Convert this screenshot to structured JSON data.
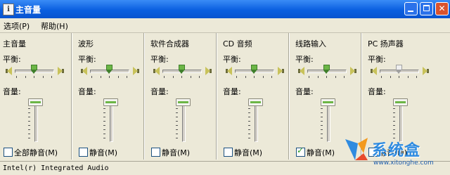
{
  "window": {
    "title": "主音量",
    "app_icon": "i",
    "minimize_icon": "minimize-icon",
    "maximize_icon": "maximize-icon",
    "close_icon": "close-icon"
  },
  "menu": {
    "items": [
      "选项(P)",
      "帮助(H)"
    ]
  },
  "balance_label": "平衡:",
  "volume_label": "音量:",
  "channels": [
    {
      "title": "主音量",
      "mute_label": "全部静音(M)",
      "muted": false,
      "enabled": true,
      "balance": 0.5,
      "volume": 1.0
    },
    {
      "title": "波形",
      "mute_label": "静音(M)",
      "muted": false,
      "enabled": true,
      "balance": 0.5,
      "volume": 1.0
    },
    {
      "title": "软件合成器",
      "mute_label": "静音(M)",
      "muted": false,
      "enabled": true,
      "balance": 0.5,
      "volume": 1.0
    },
    {
      "title": "CD 音频",
      "mute_label": "静音(M)",
      "muted": false,
      "enabled": true,
      "balance": 0.5,
      "volume": 1.0
    },
    {
      "title": "线路输入",
      "mute_label": "静音(M)",
      "muted": true,
      "enabled": true,
      "balance": 0.5,
      "volume": 1.0
    },
    {
      "title": "PC 扬声器",
      "mute_label": "静音(M)",
      "muted": false,
      "enabled": false,
      "balance": 0.5,
      "volume": 1.0
    }
  ],
  "status": "Intel(r) Integrated Audio",
  "watermark": {
    "text": "系统盒",
    "url": "www.xitonghe.com",
    "colors": [
      "#2f8be0",
      "#f39a1e",
      "#e84b2c"
    ]
  }
}
